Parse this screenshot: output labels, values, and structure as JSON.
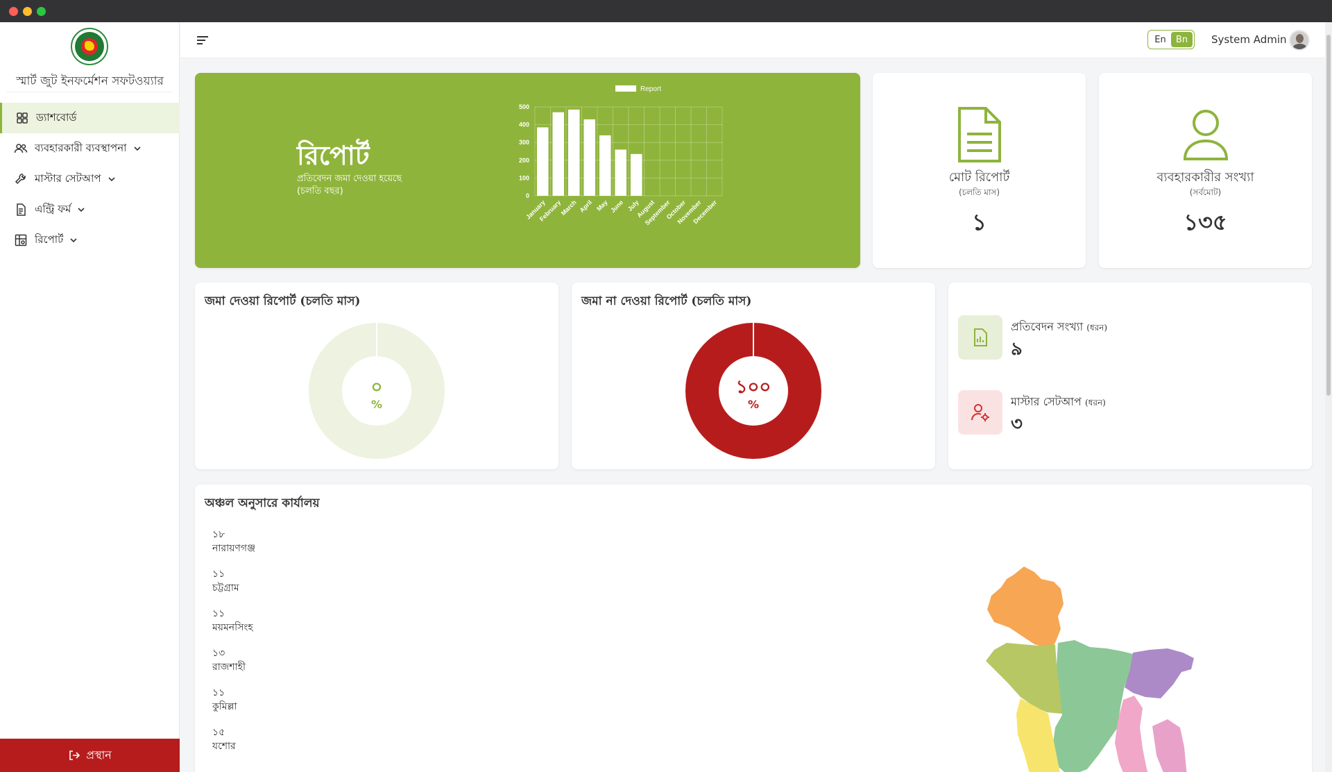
{
  "app": {
    "name": "স্মার্ট জুট ইনফর্মেশন সফটওয়্যার"
  },
  "sidebar": {
    "items": [
      {
        "label": "ড্যাশবোর্ড",
        "icon": "grid-icon",
        "active": true
      },
      {
        "label": "ব্যবহারকারী ব্যবস্থাপনা",
        "icon": "users-icon",
        "expandable": true
      },
      {
        "label": "মাস্টার সেটআপ",
        "icon": "wrench-icon",
        "expandable": true
      },
      {
        "label": "এন্ট্রি ফর্ম",
        "icon": "document-icon",
        "expandable": true
      },
      {
        "label": "রিপোর্ট",
        "icon": "report-icon",
        "expandable": true
      }
    ],
    "logout_label": "প্রস্থান"
  },
  "header": {
    "lang_en": "En",
    "lang_bn": "Bn",
    "user_name": "System Admin"
  },
  "report_card": {
    "title": "রিপোর্ট",
    "subtitle": "প্রতিবেদন জমা দেওয়া হয়েছে (চলতি বছর)"
  },
  "stats": {
    "total_report": {
      "label": "মোট রিপোর্ট",
      "note": "(চলতি মাস)",
      "value": "১"
    },
    "user_count": {
      "label": "ব্যবহারকারীর সংখ্যা",
      "note": "(সর্বমোট)",
      "value": "১৩৫"
    }
  },
  "donuts": {
    "submitted": {
      "title": "জমা দেওয়া রিপোর্ট (চলতি মাস)",
      "value": "০",
      "percent_sign": "%",
      "fraction": 0
    },
    "not_submitted": {
      "title": "জমা না দেওয়া রিপোর্ট (চলতি মাস)",
      "value": "১০০",
      "percent_sign": "%",
      "fraction": 1
    }
  },
  "counts": {
    "report_types": {
      "label": "প্রতিবেদন সংখ্যা",
      "note": "(ধরন)",
      "value": "৯"
    },
    "master_setup": {
      "label": "মাস্টার সেটআপ",
      "note": "(ধরন)",
      "value": "৩"
    }
  },
  "regions": {
    "title": "অঞ্চল অনুসারে কার্যালয়",
    "items": [
      {
        "count": "১৮",
        "name": "নারায়ণগঞ্জ"
      },
      {
        "count": "১১",
        "name": "চট্টগ্রাম"
      },
      {
        "count": "১১",
        "name": "ময়মনসিংহ"
      },
      {
        "count": "১৩",
        "name": "রাজশাহী"
      },
      {
        "count": "১১",
        "name": "কুমিল্লা"
      },
      {
        "count": "১৫",
        "name": "যশোর"
      }
    ]
  },
  "colors": {
    "brand_green": "#8fb43b",
    "accent_red": "#b71c1c",
    "donut_empty": "#eef2e0"
  },
  "chart_data": {
    "type": "bar",
    "legend": "Report",
    "categories": [
      "January",
      "February",
      "March",
      "April",
      "May",
      "June",
      "July",
      "August",
      "September",
      "October",
      "November",
      "December"
    ],
    "values": [
      385,
      470,
      485,
      430,
      340,
      260,
      235,
      0,
      0,
      0,
      0,
      0
    ],
    "ylim": [
      0,
      500
    ],
    "yticks": [
      0,
      100,
      200,
      300,
      400,
      500
    ],
    "grid": true,
    "legend_position": "top"
  }
}
